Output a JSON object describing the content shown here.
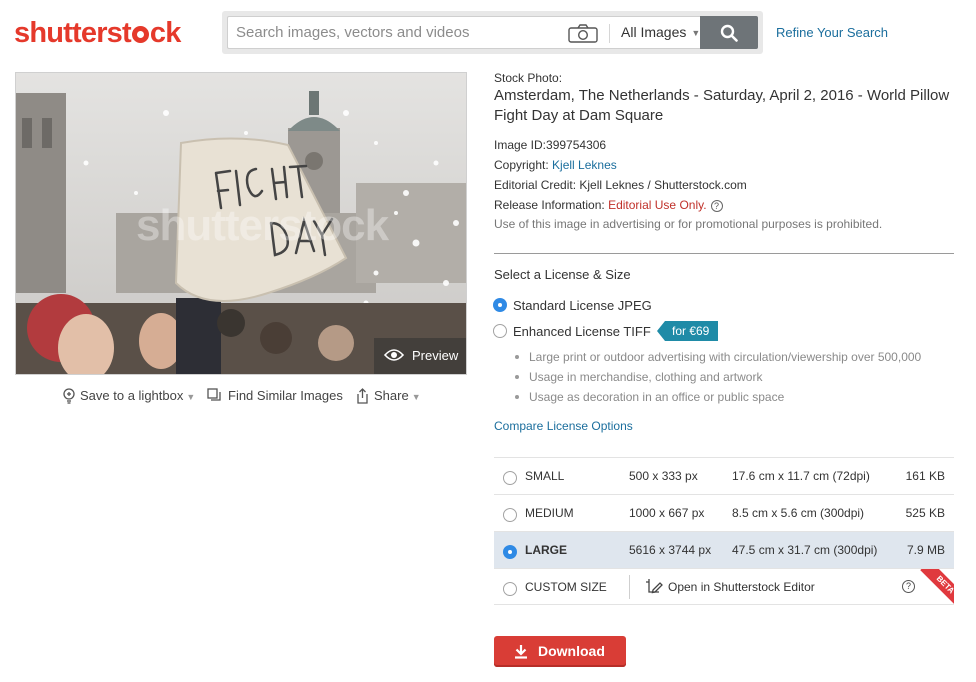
{
  "brand": {
    "logo_prefix": "shutterst",
    "logo_suffix": "ck",
    "accent": "#e5392b"
  },
  "search": {
    "placeholder": "Search images, vectors and videos",
    "value": "",
    "filter_selected": "All Images",
    "refine_label": "Refine Your Search"
  },
  "image": {
    "watermark": "shutterstock",
    "preview_label": "Preview",
    "actions": {
      "save": "Save to a lightbox",
      "similar": "Find Similar Images",
      "share": "Share"
    }
  },
  "details": {
    "kind": "Stock Photo:",
    "title": "Amsterdam, The Netherlands - Saturday, April 2, 2016 - World Pillow Fight Day at Dam Square",
    "image_id_label": "Image ID:",
    "image_id": "399754306",
    "copyright_label": "Copyright:",
    "copyright_value": "Kjell Leknes",
    "credit_label": "Editorial Credit:",
    "credit_value": "Kjell Leknes / Shutterstock.com",
    "release_label": "Release Information:",
    "release_value": "Editorial Use Only.",
    "prohibited": "Use of this image in advertising or for promotional purposes is prohibited."
  },
  "license": {
    "section_label": "Select a License & Size",
    "options": [
      {
        "label": "Standard License JPEG",
        "selected": true
      },
      {
        "label": "Enhanced License TIFF",
        "selected": false,
        "price": "for €69"
      }
    ],
    "enhanced_bullets": [
      "Large print or outdoor advertising with circulation/viewership over 500,000",
      "Usage in merchandise, clothing and artwork",
      "Usage as decoration in an office or public space"
    ],
    "compare_label": "Compare License Options"
  },
  "sizes": [
    {
      "name": "SMALL",
      "dims": "500 x 333 px",
      "cm": "17.6 cm x 11.7 cm (72dpi)",
      "file_size": "161 KB",
      "selected": false
    },
    {
      "name": "MEDIUM",
      "dims": "1000 x 667 px",
      "cm": "8.5 cm x 5.6 cm (300dpi)",
      "file_size": "525 KB",
      "selected": false
    },
    {
      "name": "LARGE",
      "dims": "5616 x 3744 px",
      "cm": "47.5 cm x 31.7 cm (300dpi)",
      "file_size": "7.9 MB",
      "selected": true
    }
  ],
  "custom_size": {
    "name": "CUSTOM SIZE",
    "editor_label": "Open in Shutterstock Editor",
    "beta_label": "BETA"
  },
  "download_label": "Download",
  "icons": {
    "camera": "camera-icon",
    "search": "magnifier-icon",
    "preview": "eye-icon",
    "lightbox": "lightbulb-icon",
    "similar": "stacked-squares-icon",
    "share": "share-arrow-icon",
    "editor": "crop-pencil-icon",
    "help": "question-circle-icon",
    "download": "download-arrow-icon"
  }
}
